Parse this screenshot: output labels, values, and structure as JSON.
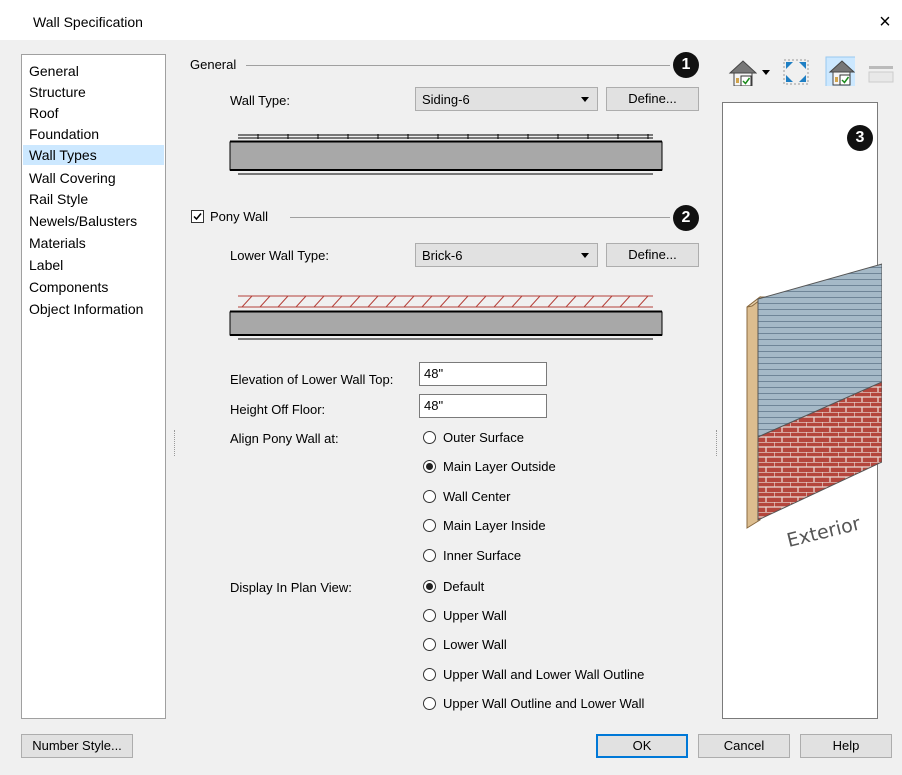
{
  "window": {
    "title": "Wall Specification",
    "close_glyph": "×"
  },
  "sidebar": {
    "items": [
      {
        "label": "General"
      },
      {
        "label": "Structure"
      },
      {
        "label": "Roof"
      },
      {
        "label": "Foundation"
      },
      {
        "label": "Wall Types",
        "selected": true
      },
      {
        "label": "Wall Covering"
      },
      {
        "label": "Rail Style"
      },
      {
        "label": "Newels/Balusters"
      },
      {
        "label": "Materials"
      },
      {
        "label": "Label"
      },
      {
        "label": "Components"
      },
      {
        "label": "Object Information"
      }
    ]
  },
  "general": {
    "section_label": "General",
    "badge": "1",
    "wall_type_label": "Wall Type:",
    "wall_type_value": "Siding-6",
    "define_label": "Define..."
  },
  "pony": {
    "checkbox_label": "Pony Wall",
    "checked": true,
    "badge": "2",
    "lower_wall_type_label": "Lower Wall Type:",
    "lower_wall_type_value": "Brick-6",
    "define_label": "Define...",
    "elevation_label": "Elevation of Lower Wall Top:",
    "elevation_value": "48\"",
    "height_label": "Height Off Floor:",
    "height_value": "48\"",
    "align_label": "Align Pony Wall at:",
    "align_options": [
      "Outer Surface",
      "Main Layer Outside",
      "Wall Center",
      "Main Layer Inside",
      "Inner Surface"
    ],
    "align_selected": 1,
    "display_label": "Display In Plan View:",
    "display_options": [
      "Default",
      "Upper Wall",
      "Lower Wall",
      "Upper Wall and Lower Wall Outline",
      "Upper Wall Outline and Lower Wall"
    ],
    "display_selected": 0
  },
  "preview": {
    "badge": "3",
    "caption": "Exterior",
    "toolbar": [
      "house-view-icon",
      "dropdown-arrow-icon",
      "fill-window-icon",
      "camera-view-icon",
      "layer-toggle-icon"
    ]
  },
  "footer": {
    "number_style_label": "Number Style...",
    "ok_label": "OK",
    "cancel_label": "Cancel",
    "help_label": "Help"
  },
  "colors": {
    "selection": "#cce8ff",
    "brick": "#b5413a",
    "siding": "#9fb4c3",
    "wood": "#d9b98a",
    "accent": "#0078d7"
  }
}
